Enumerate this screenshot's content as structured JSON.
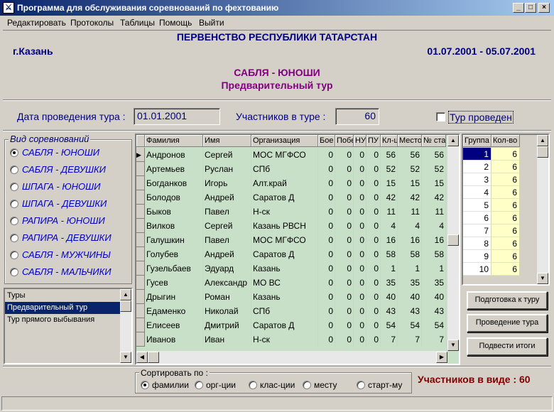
{
  "window": {
    "title": "Программа для обслуживания соревнований по фехтованию"
  },
  "menu": [
    "Редактировать",
    "Протоколы",
    "Таблицы",
    "Помощь",
    "Выйти"
  ],
  "header": {
    "championship": "ПЕРВЕНСТВО РЕСПУБЛИКИ ТАТАРСТАН",
    "city": "г.Казань",
    "dates": "01.07.2001  -  05.07.2001",
    "competition": "САБЛЯ - ЮНОШИ",
    "stage": "Предварительный тур"
  },
  "info": {
    "date_label": "Дата проведения тура :",
    "date_value": "01.01.2001",
    "participants_label": "Участников в туре :",
    "participants_value": "60",
    "round_done_label": "Тур проведен",
    "round_done_checked": false
  },
  "sport_group": {
    "title": "Вид соревнований",
    "selected": 0,
    "options": [
      "САБЛЯ - ЮНОШИ",
      "САБЛЯ - ДЕВУШКИ",
      "ШПАГА - ЮНОШИ",
      "ШПАГА - ДЕВУШКИ",
      "РАПИРА - ЮНОШИ",
      "РАПИРА - ДЕВУШКИ",
      "САБЛЯ - МУЖЧИНЫ",
      "САБЛЯ - МАЛЬЧИКИ"
    ]
  },
  "tours": {
    "items": [
      "Туры",
      "Предварительный тур",
      "Тур прямого выбывания"
    ],
    "selected": 1
  },
  "table": {
    "columns": [
      "Фамилия",
      "Имя",
      "Организация",
      "Бое",
      "Побе",
      "НУ",
      "ПУ",
      "Кл-ц",
      "Место",
      "№ ста"
    ],
    "rows": [
      [
        "Андронов",
        "Сергей",
        "МОС МГФСО",
        "0",
        "0",
        "0",
        "0",
        "56",
        "56",
        "56"
      ],
      [
        "Артемьев",
        "Руслан",
        "СПб",
        "0",
        "0",
        "0",
        "0",
        "52",
        "52",
        "52"
      ],
      [
        "Богданков",
        "Игорь",
        "Алт.край",
        "0",
        "0",
        "0",
        "0",
        "15",
        "15",
        "15"
      ],
      [
        "Болодов",
        "Андрей",
        "Саратов Д",
        "0",
        "0",
        "0",
        "0",
        "42",
        "42",
        "42"
      ],
      [
        "Быков",
        "Павел",
        "Н-ск",
        "0",
        "0",
        "0",
        "0",
        "11",
        "11",
        "11"
      ],
      [
        "Вилков",
        "Сергей",
        "Казань РВСН",
        "0",
        "0",
        "0",
        "0",
        "4",
        "4",
        "4"
      ],
      [
        "Галушкин",
        "Павел",
        "МОС МГФСО",
        "0",
        "0",
        "0",
        "0",
        "16",
        "16",
        "16"
      ],
      [
        "Голубев",
        "Андрей",
        "Саратов Д",
        "0",
        "0",
        "0",
        "0",
        "58",
        "58",
        "58"
      ],
      [
        "Гузельбаев",
        "Эдуард",
        "Казань",
        "0",
        "0",
        "0",
        "0",
        "1",
        "1",
        "1"
      ],
      [
        "Гусев",
        "Александр",
        "МО ВС",
        "0",
        "0",
        "0",
        "0",
        "35",
        "35",
        "35"
      ],
      [
        "Дрыгин",
        "Роман",
        "Казань",
        "0",
        "0",
        "0",
        "0",
        "40",
        "40",
        "40"
      ],
      [
        "Едаменко",
        "Николай",
        "СПб",
        "0",
        "0",
        "0",
        "0",
        "43",
        "43",
        "43"
      ],
      [
        "Елисеев",
        "Дмитрий",
        "Саратов Д",
        "0",
        "0",
        "0",
        "0",
        "54",
        "54",
        "54"
      ],
      [
        "Иванов",
        "Иван",
        "Н-ск",
        "0",
        "0",
        "0",
        "0",
        "7",
        "7",
        "7"
      ]
    ]
  },
  "groups": {
    "columns": [
      "Группа",
      "Кол-во"
    ],
    "rows": [
      [
        "1",
        "6"
      ],
      [
        "2",
        "6"
      ],
      [
        "3",
        "6"
      ],
      [
        "4",
        "6"
      ],
      [
        "5",
        "6"
      ],
      [
        "6",
        "6"
      ],
      [
        "7",
        "6"
      ],
      [
        "8",
        "6"
      ],
      [
        "9",
        "6"
      ],
      [
        "10",
        "6"
      ]
    ]
  },
  "buttons": {
    "prepare": "Подготовка к туру",
    "run": "Проведение тура",
    "results": "Подвести итоги"
  },
  "sort": {
    "title": "Сортировать по :",
    "options": [
      "фамилии",
      "орг-ции",
      "клас-ции",
      "месту",
      "старт-му"
    ],
    "selected": 0
  },
  "footer": {
    "in_view": "Участников в виде : 60"
  },
  "colors": {
    "accent": "#000080",
    "title_purple": "#800080",
    "grid_bg": "#c8e0c8",
    "footer_red": "#800000"
  }
}
